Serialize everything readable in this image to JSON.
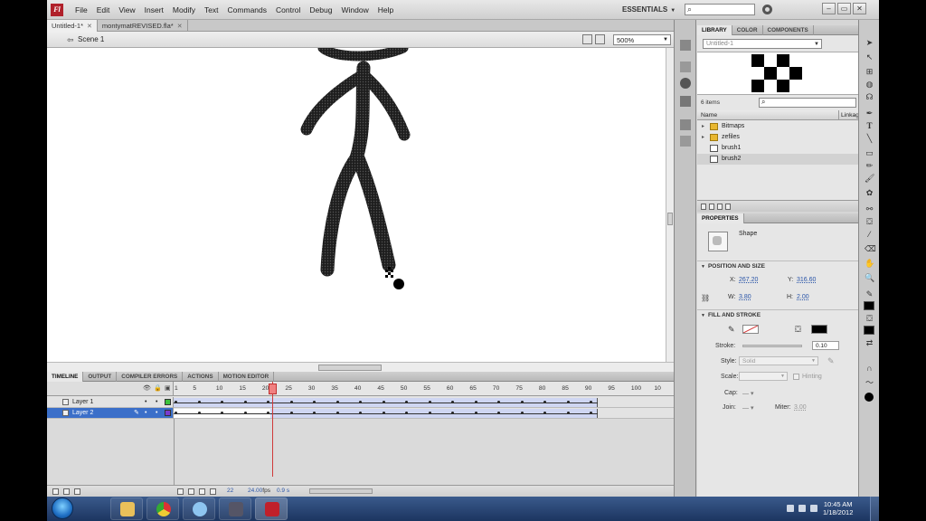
{
  "menu": {
    "items": [
      "File",
      "Edit",
      "View",
      "Insert",
      "Modify",
      "Text",
      "Commands",
      "Control",
      "Debug",
      "Window",
      "Help"
    ],
    "workspace": "ESSENTIALS",
    "logo": "Fl"
  },
  "doc_tabs": [
    {
      "label": "Untitled-1*"
    },
    {
      "label": "montymatREVISED.fla*"
    }
  ],
  "edit_bar": {
    "scene": "Scene 1",
    "zoom": "500%"
  },
  "timeline": {
    "tabs": [
      "TIMELINE",
      "OUTPUT",
      "COMPILER ERRORS",
      "ACTIONS",
      "MOTION EDITOR"
    ],
    "frame_numbers": [
      "1",
      "5",
      "10",
      "15",
      "20",
      "25",
      "30",
      "35",
      "40",
      "45",
      "50",
      "55",
      "60",
      "65",
      "70",
      "75",
      "80",
      "85",
      "90",
      "95",
      "100",
      "10"
    ],
    "layers": [
      {
        "name": "Layer 1",
        "color": "#3cc23c"
      },
      {
        "name": "Layer 2",
        "color": "#7a3cd0"
      }
    ],
    "current_frame": "22",
    "fps": "24.00",
    "fps_unit": "fps",
    "elapsed": "0.9 s",
    "playhead_frame": 22,
    "total_visible_frames": 108,
    "filled_until_frame": 92
  },
  "library": {
    "tabs": [
      "LIBRARY",
      "COLOR",
      "COMPONENTS"
    ],
    "document": "Untitled-1",
    "count": "6 items",
    "col_name": "Name",
    "col_linkage": "Linkag",
    "items": [
      {
        "name": "Bitmaps",
        "kind": "folder"
      },
      {
        "name": "zefiles",
        "kind": "folder"
      },
      {
        "name": "brush1",
        "kind": "bitmap"
      },
      {
        "name": "brush2",
        "kind": "bitmap"
      }
    ]
  },
  "properties": {
    "tab": "PROPERTIES",
    "type": "Shape",
    "sections": {
      "position": "POSITION AND SIZE",
      "fill": "FILL AND STROKE"
    },
    "x_label": "X:",
    "x": "267.20",
    "y_label": "Y:",
    "y": "316.60",
    "w_label": "W:",
    "w": "3.80",
    "h_label": "H:",
    "h": "2.00",
    "stroke_label": "Stroke:",
    "stroke": "0.10",
    "style_label": "Style:",
    "style": "Solid",
    "scale_label": "Scale:",
    "hinting": "Hinting",
    "cap_label": "Cap:",
    "join_label": "Join:",
    "miter_label": "Miter:",
    "miter": "3.00",
    "fill_color": "#000000"
  },
  "taskbar": {
    "time": "10:45 AM",
    "date": "1/18/2012"
  }
}
